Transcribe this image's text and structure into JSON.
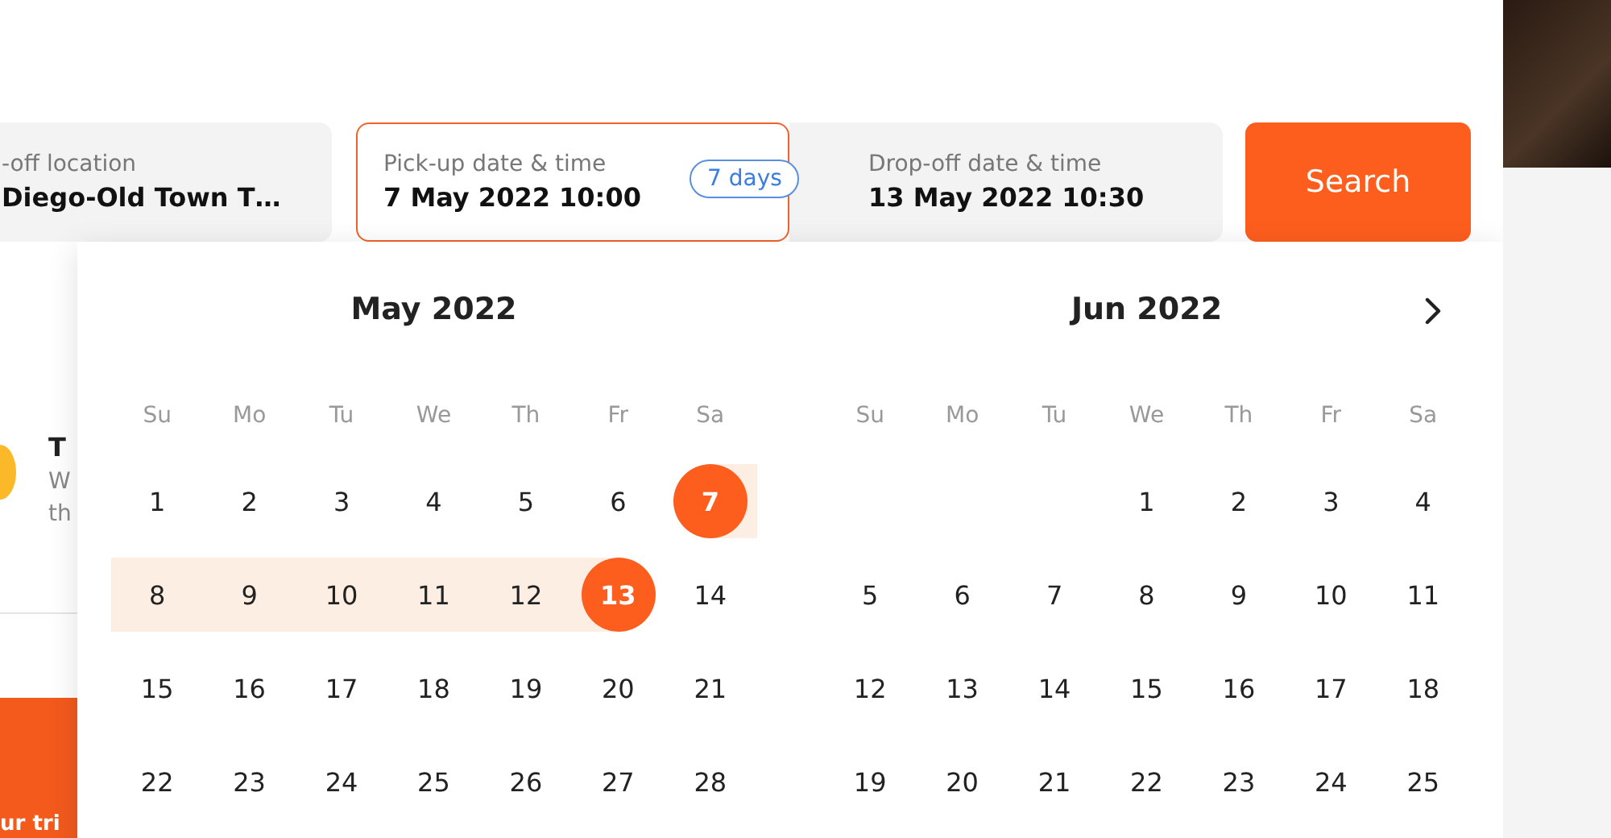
{
  "search_bar": {
    "fields": [
      {
        "label": "-off location",
        "value": "Diego-Old Town T…",
        "selected": false
      },
      {
        "label": "Pick-up date & time",
        "value": "7 May 2022 10:00",
        "selected": true
      },
      {
        "label": "Drop-off date & time",
        "value": "13 May 2022 10:30",
        "selected": false
      }
    ],
    "duration_badge": "7 days",
    "search_button": "Search"
  },
  "background_card": {
    "title": "T",
    "text_lines": [
      "W",
      "th"
    ]
  },
  "promo_banner": {
    "text": "ur tri"
  },
  "calendar": {
    "months": [
      {
        "title": "May 2022",
        "weekdays": [
          "Su",
          "Mo",
          "Tu",
          "We",
          "Th",
          "Fr",
          "Sa"
        ],
        "weeks": [
          [
            {
              "label": "1",
              "kind": "plain"
            },
            {
              "label": "2",
              "kind": "plain"
            },
            {
              "label": "3",
              "kind": "plain"
            },
            {
              "label": "4",
              "kind": "plain"
            },
            {
              "label": "5",
              "kind": "plain"
            },
            {
              "label": "6",
              "kind": "plain"
            },
            {
              "label": "7",
              "kind": "start"
            }
          ],
          [
            {
              "label": "8",
              "kind": "range"
            },
            {
              "label": "9",
              "kind": "range"
            },
            {
              "label": "10",
              "kind": "range"
            },
            {
              "label": "11",
              "kind": "range"
            },
            {
              "label": "12",
              "kind": "range"
            },
            {
              "label": "13",
              "kind": "end"
            },
            {
              "label": "14",
              "kind": "plain"
            }
          ],
          [
            {
              "label": "15",
              "kind": "plain"
            },
            {
              "label": "16",
              "kind": "plain"
            },
            {
              "label": "17",
              "kind": "plain"
            },
            {
              "label": "18",
              "kind": "plain"
            },
            {
              "label": "19",
              "kind": "plain"
            },
            {
              "label": "20",
              "kind": "plain"
            },
            {
              "label": "21",
              "kind": "plain"
            }
          ],
          [
            {
              "label": "22",
              "kind": "plain"
            },
            {
              "label": "23",
              "kind": "plain"
            },
            {
              "label": "24",
              "kind": "plain"
            },
            {
              "label": "25",
              "kind": "plain"
            },
            {
              "label": "26",
              "kind": "plain"
            },
            {
              "label": "27",
              "kind": "plain"
            },
            {
              "label": "28",
              "kind": "plain"
            }
          ]
        ]
      },
      {
        "title": "Jun 2022",
        "weekdays": [
          "Su",
          "Mo",
          "Tu",
          "We",
          "Th",
          "Fr",
          "Sa"
        ],
        "weeks": [
          [
            {
              "kind": "blank"
            },
            {
              "kind": "blank"
            },
            {
              "kind": "blank"
            },
            {
              "label": "1",
              "kind": "plain"
            },
            {
              "label": "2",
              "kind": "plain"
            },
            {
              "label": "3",
              "kind": "plain"
            },
            {
              "label": "4",
              "kind": "plain"
            }
          ],
          [
            {
              "label": "5",
              "kind": "plain"
            },
            {
              "label": "6",
              "kind": "plain"
            },
            {
              "label": "7",
              "kind": "plain"
            },
            {
              "label": "8",
              "kind": "plain"
            },
            {
              "label": "9",
              "kind": "plain"
            },
            {
              "label": "10",
              "kind": "plain"
            },
            {
              "label": "11",
              "kind": "plain"
            }
          ],
          [
            {
              "label": "12",
              "kind": "plain"
            },
            {
              "label": "13",
              "kind": "plain"
            },
            {
              "label": "14",
              "kind": "plain"
            },
            {
              "label": "15",
              "kind": "plain"
            },
            {
              "label": "16",
              "kind": "plain"
            },
            {
              "label": "17",
              "kind": "plain"
            },
            {
              "label": "18",
              "kind": "plain"
            }
          ],
          [
            {
              "label": "19",
              "kind": "plain"
            },
            {
              "label": "20",
              "kind": "plain"
            },
            {
              "label": "21",
              "kind": "plain"
            },
            {
              "label": "22",
              "kind": "plain"
            },
            {
              "label": "23",
              "kind": "plain"
            },
            {
              "label": "24",
              "kind": "plain"
            },
            {
              "label": "25",
              "kind": "plain"
            }
          ]
        ]
      }
    ]
  }
}
